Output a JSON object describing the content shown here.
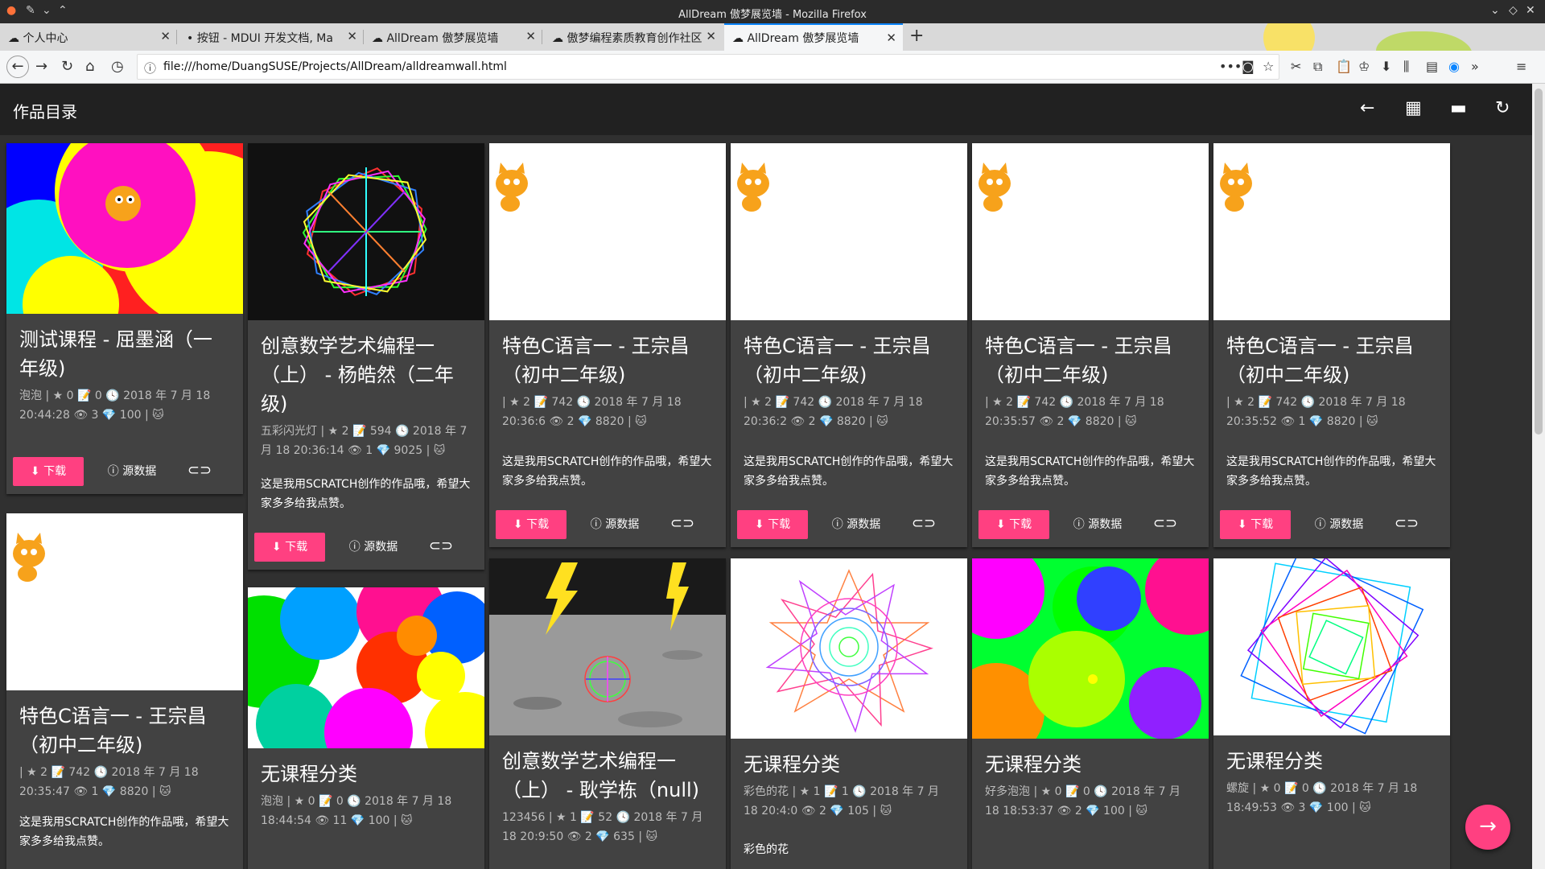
{
  "window": {
    "title": "AllDream 傲梦展览墙 - Mozilla Firefox"
  },
  "tabs": [
    {
      "label": "个人中心",
      "active": false
    },
    {
      "label": "按钮 - MDUI 开发文档, Ma",
      "active": false
    },
    {
      "label": "AllDream 傲梦展览墙",
      "active": false
    },
    {
      "label": "傲梦编程素质教育创作社区",
      "active": false
    },
    {
      "label": "AllDream 傲梦展览墙",
      "active": true
    }
  ],
  "address": {
    "url": "file:///home/DuangSUSE/Projects/AllDream/alldreamwall.html"
  },
  "appbar": {
    "title": "作品目录"
  },
  "cards": [
    {
      "title": "测试课程 - 屈墨涵（一年级)",
      "meta": "泡泡 | ★ 0 📝 0 🕓 2018 年 7 月 18 20:44:28 👁 3 💎 100 | 🐱",
      "desc": "",
      "image": "circles-pink-cat"
    },
    {
      "title": "创意数学艺术编程一（上） - 杨皓然（二年级)",
      "meta": "五彩闪光灯 | ★ 2 📝 594 🕓 2018 年 7 月 18 20:36:14 👁 1 💎 9025 | 🐱",
      "desc": "这是我用SCRATCH创作的作品哦，希望大家多多给我点赞。",
      "image": "star-polygon-dark"
    },
    {
      "title": "特色C语言一 - 王宗昌（初中二年级)",
      "meta": "| ★ 2 📝 742 🕓 2018 年 7 月 18 20:36:6 👁 2 💎 8820 | 🐱",
      "desc": "这是我用SCRATCH创作的作品哦，希望大家多多给我点赞。",
      "image": "white-cat"
    },
    {
      "title": "特色C语言一 - 王宗昌（初中二年级)",
      "meta": "| ★ 2 📝 742 🕓 2018 年 7 月 18 20:36:2 👁 2 💎 8820 | 🐱",
      "desc": "这是我用SCRATCH创作的作品哦，希望大家多多给我点赞。",
      "image": "white-cat"
    },
    {
      "title": "特色C语言一 - 王宗昌（初中二年级)",
      "meta": "| ★ 2 📝 742 🕓 2018 年 7 月 18 20:35:57 👁 2 💎 8820 | 🐱",
      "desc": "这是我用SCRATCH创作的作品哦，希望大家多多给我点赞。",
      "image": "white-cat"
    },
    {
      "title": "特色C语言一 - 王宗昌（初中二年级)",
      "meta": "| ★ 2 📝 742 🕓 2018 年 7 月 18 20:35:52 👁 1 💎 8820 | 🐱",
      "desc": "这是我用SCRATCH创作的作品哦，希望大家多多给我点赞。",
      "image": "white-cat"
    },
    {
      "title": "特色C语言一 - 王宗昌（初中二年级)",
      "meta": "| ★ 2 📝 742 🕓 2018 年 7 月 18 20:35:47 👁 1 💎 8820 | 🐱",
      "desc": "这是我用SCRATCH创作的作品哦，希望大家多多给我点赞。",
      "image": "white-cat"
    },
    {
      "title": "无课程分类",
      "meta": "泡泡 | ★ 0 📝 0 🕓 2018 年 7 月 18 18:44:54 👁 11 💎 100 | 🐱",
      "desc": "",
      "image": "colorful-circles"
    },
    {
      "title": "创意数学艺术编程一（上） - 耿学栋（null)",
      "meta": "123456 | ★ 1 📝 52 🕓 2018 年 7 月 18 20:9:50 👁 2 💎 635 | 🐱",
      "desc": "",
      "image": "moon-lightning"
    },
    {
      "title": "无课程分类",
      "meta": "彩色的花 | ★ 1 📝 1 🕓 2018 年 7 月 18 20:4:0 👁 2 💎 105 | 🐱",
      "desc": "彩色的花",
      "image": "rainbow-flower"
    },
    {
      "title": "无课程分类",
      "meta": "好多泡泡 | ★ 0 📝 0 🕓 2018 年 7 月 18 18:53:37 👁 2 💎 100 | 🐱",
      "desc": "",
      "image": "green-bubbles"
    },
    {
      "title": "无课程分类",
      "meta": "螺旋 | ★ 0 📝 0 🕓 2018 年 7 月 18 18:49:53 👁 3 💎 100 | 🐱",
      "desc": "",
      "image": "rainbow-spiral"
    }
  ],
  "buttons": {
    "download": "下载",
    "source": "源数据"
  },
  "colors": {
    "accent": "#ff4081",
    "appbar": "#212121",
    "card": "#424242",
    "background": "#303030"
  }
}
